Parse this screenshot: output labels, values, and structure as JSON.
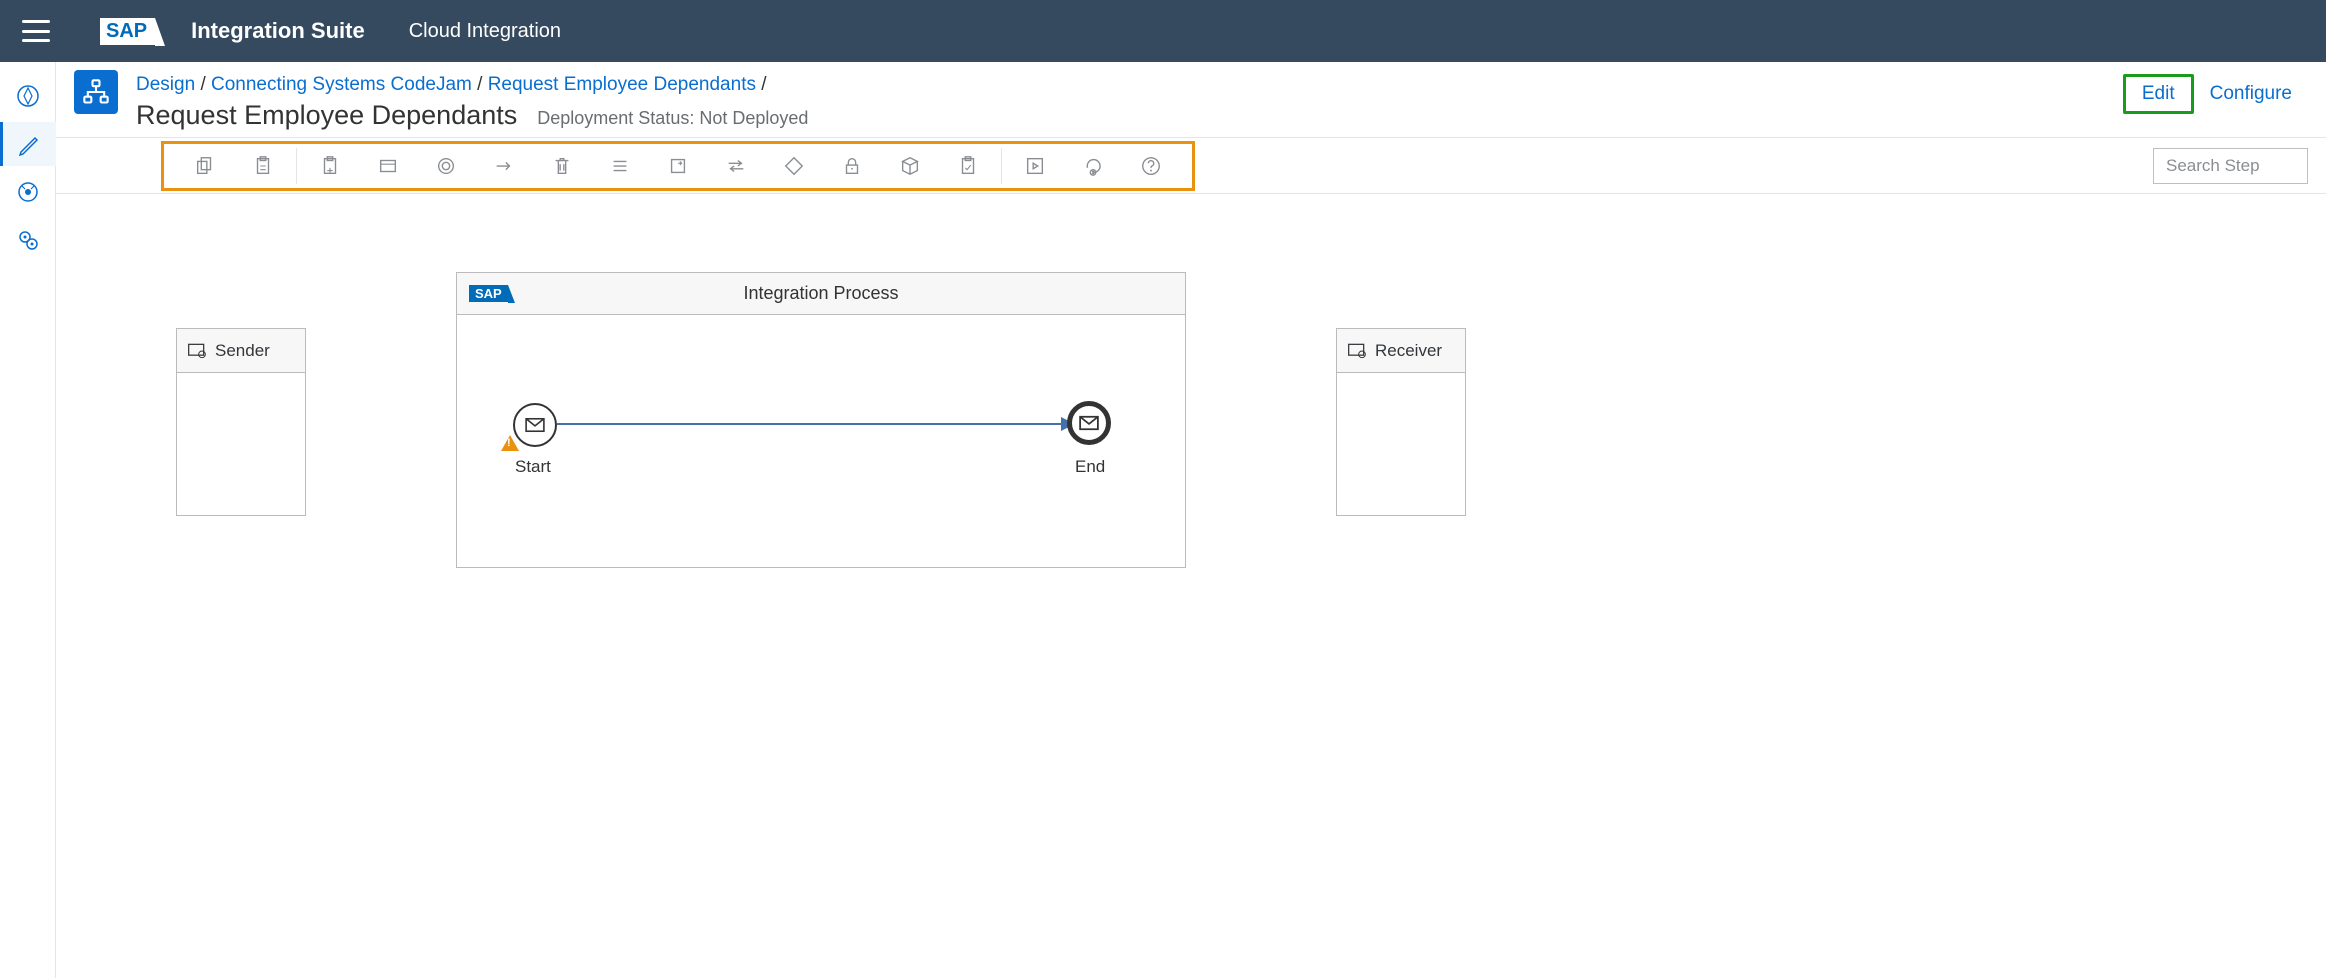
{
  "topbar": {
    "app_title": "Integration Suite",
    "app_subtitle": "Cloud Integration",
    "logo_text": "SAP"
  },
  "header": {
    "breadcrumb": {
      "design": "Design",
      "pkg": "Connecting Systems CodeJam",
      "artifact": "Request Employee Dependants",
      "sep": "/"
    },
    "title": "Request Employee Dependants",
    "deployment_status": "Deployment Status: Not Deployed",
    "actions": {
      "edit": "Edit",
      "configure": "Configure"
    }
  },
  "toolbar": {
    "search_placeholder": "Search Step"
  },
  "canvas": {
    "process_title": "Integration Process",
    "process_logo": "SAP",
    "sender_label": "Sender",
    "receiver_label": "Receiver",
    "start_label": "Start",
    "end_label": "End"
  }
}
